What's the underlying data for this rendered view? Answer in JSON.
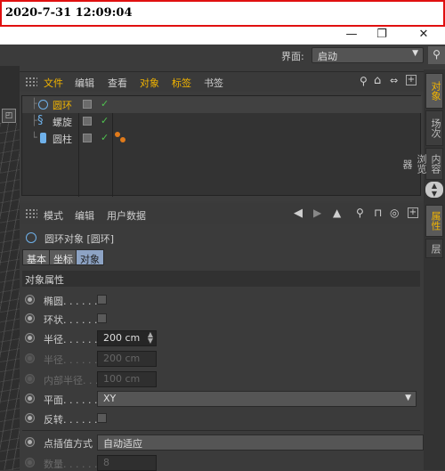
{
  "timestamp": "2020-7-31 12:09:04",
  "window": {
    "minimize_icon": "—",
    "restore_icon": "❐",
    "close_icon": "✕"
  },
  "topbar": {
    "layout_label": "界面:",
    "layout_value": "启动",
    "search_icon": "⚲"
  },
  "object_manager": {
    "menu": [
      "文件",
      "编辑",
      "查看",
      "对象",
      "标签",
      "书签"
    ],
    "objects": [
      {
        "name": "圆环",
        "selected": true
      },
      {
        "name": "螺旋",
        "selected": false
      },
      {
        "name": "圆柱",
        "selected": false
      }
    ]
  },
  "right_tabs": {
    "top": [
      "对象",
      "场次",
      "内容浏览器"
    ],
    "bottom": [
      "属性",
      "层"
    ]
  },
  "attribute_manager": {
    "menu": [
      "模式",
      "编辑",
      "用户数据"
    ],
    "object_title": "圆环对象 [圆环]",
    "tabs": [
      "基本",
      "坐标",
      "对象"
    ],
    "section": "对象属性",
    "props": {
      "ellipse": "椭圆. . . . . .",
      "ring": "环状. . . . . .",
      "radius": "半径. . . . . .",
      "radius_value": "200 cm",
      "radius2": "半径. . . . . .",
      "radius2_value": "200 cm",
      "inner_radius": "内部半径. . .",
      "inner_radius_value": "100 cm",
      "plane": "平面. . . . . .",
      "plane_value": "XY",
      "reverse": "反转. . . . . .",
      "interp": "点插值方式",
      "interp_value": "自动适应",
      "count": "数量. . . . . .",
      "count_value": "8"
    }
  },
  "colors": {
    "accent": "#f2b400",
    "checkmark": "#4fc24f",
    "tab_active": "#8da3c4"
  }
}
